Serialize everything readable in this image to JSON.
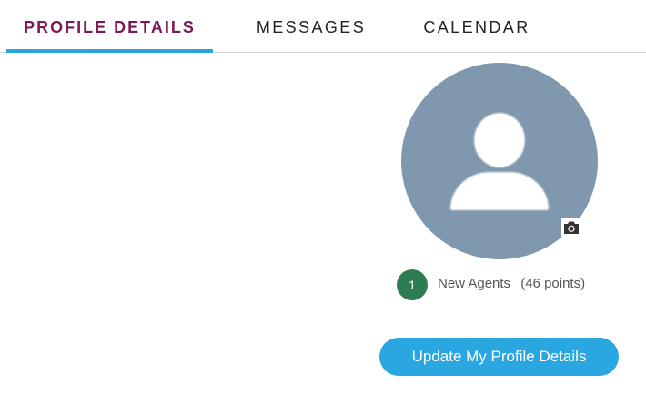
{
  "tabs": [
    {
      "label": "PROFILE DETAILS",
      "active": true
    },
    {
      "label": "MESSAGES",
      "active": false
    },
    {
      "label": "CALENDAR",
      "active": false
    }
  ],
  "profile": {
    "avatar_icon": "user-silhouette-icon",
    "upload_icon": "camera-icon",
    "rank_number": "1",
    "rank_name": "New Agents",
    "rank_points": "(46 points)",
    "update_button_label": "Update My Profile Details"
  },
  "colors": {
    "active_tab_text": "#7a1a55",
    "active_tab_underline": "#2aa6dc",
    "avatar_background": "#8098ae",
    "rank_badge": "#2e7d52",
    "primary_button": "#2aa6e0"
  }
}
